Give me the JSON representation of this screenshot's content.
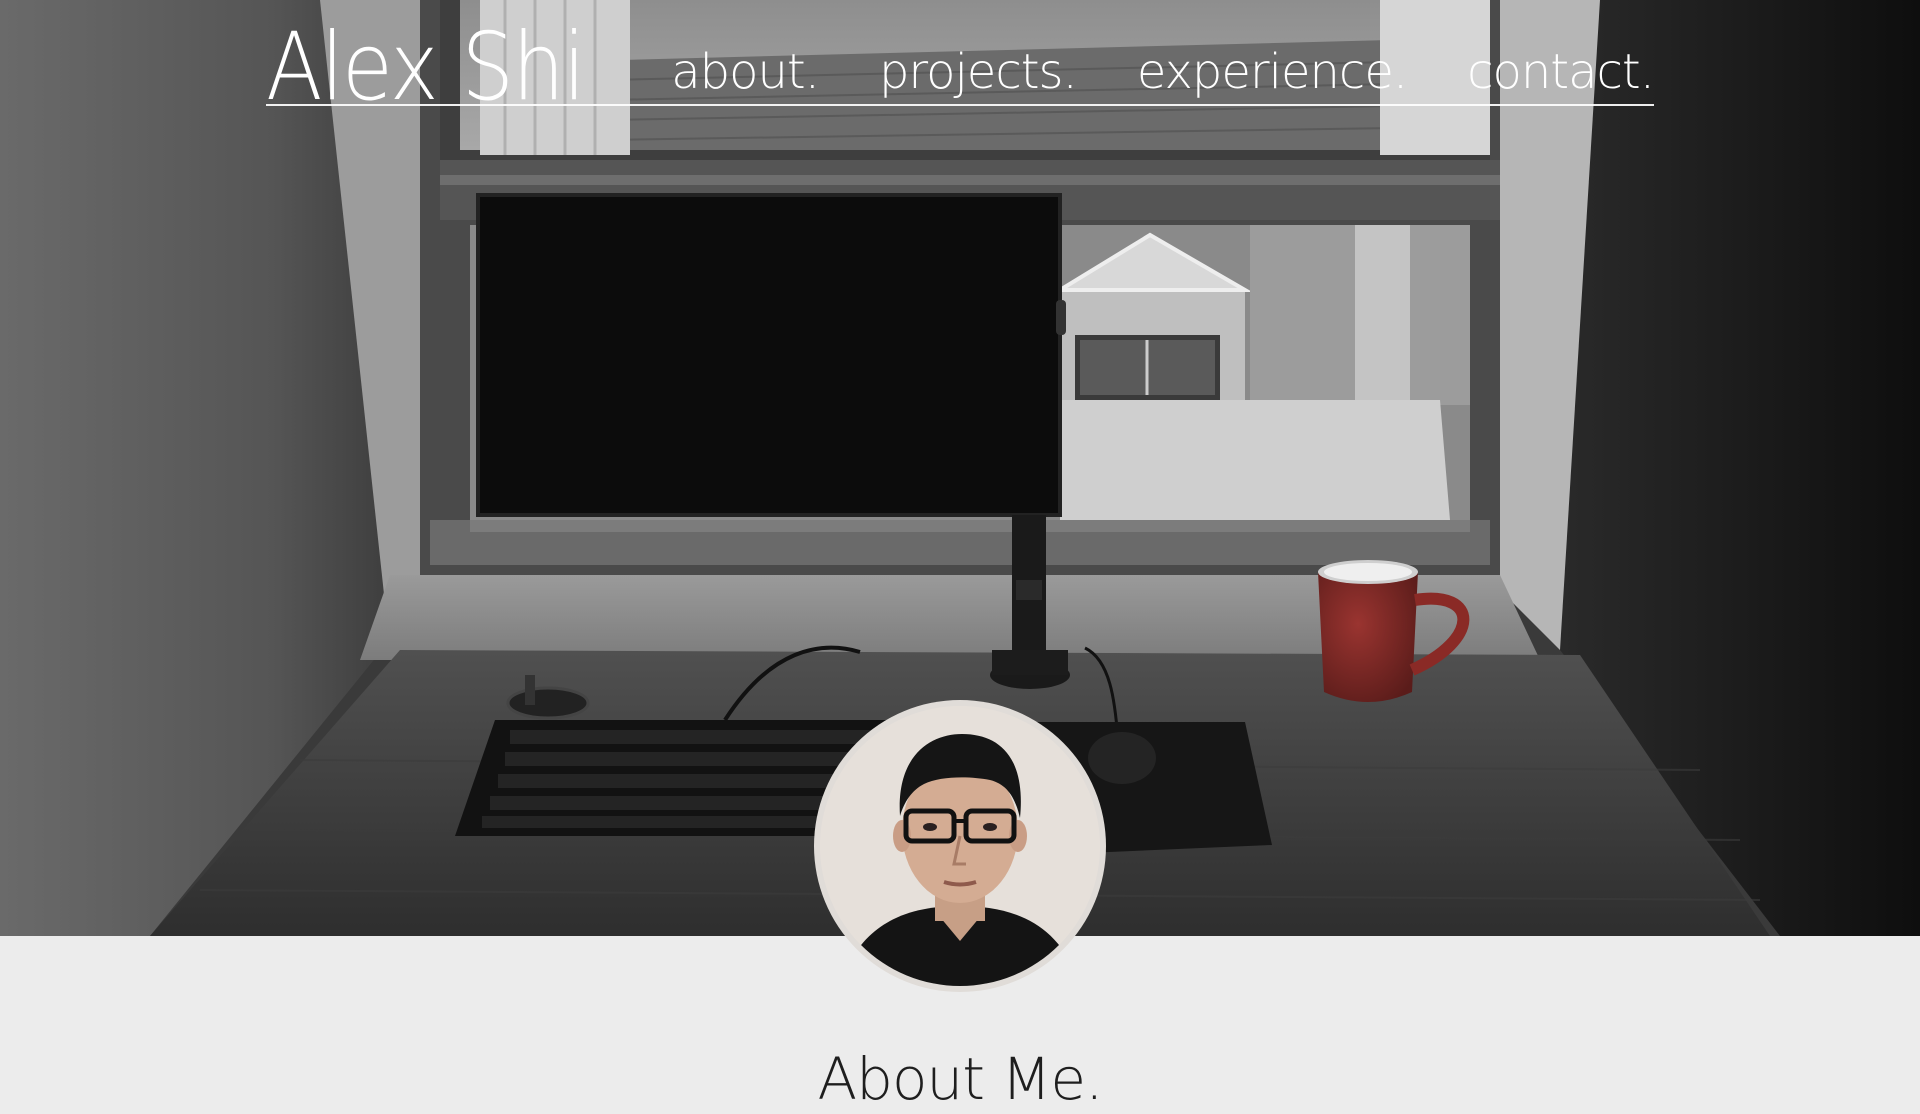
{
  "site": {
    "brand": "Alex Shi"
  },
  "nav": {
    "items": [
      {
        "label": "about."
      },
      {
        "label": "projects."
      },
      {
        "label": "experience."
      },
      {
        "label": "contact."
      }
    ]
  },
  "about": {
    "title": "About Me."
  },
  "hero": {
    "image": "desk-setup-photo",
    "tone": "grayscale"
  },
  "colors": {
    "nav_text": "#ffffff",
    "section_bg": "#ececec",
    "heading": "#1e1e1e",
    "mug": "#8a2a26"
  }
}
